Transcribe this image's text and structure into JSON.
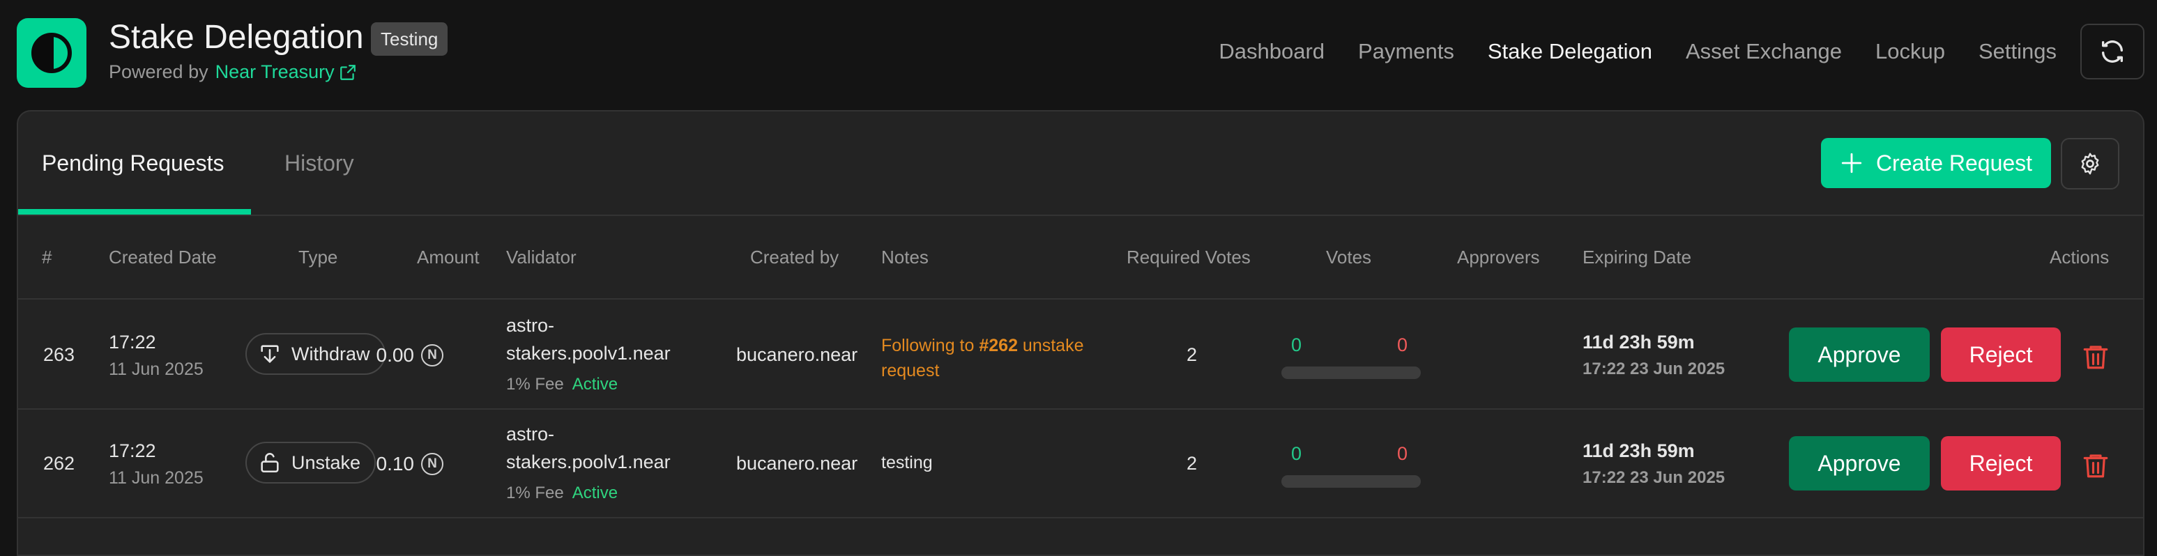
{
  "header": {
    "title": "Stake Delegation",
    "badge": "Testing",
    "powered_prefix": "Powered by",
    "powered_link": "Near Treasury",
    "nav": [
      "Dashboard",
      "Payments",
      "Stake Delegation",
      "Asset Exchange",
      "Lockup",
      "Settings"
    ],
    "active_nav": "Stake Delegation"
  },
  "tabs": [
    "Pending Requests",
    "History"
  ],
  "actions": {
    "create_label": "Create Request"
  },
  "table": {
    "columns": [
      "#",
      "Created Date",
      "Type",
      "Amount",
      "Validator",
      "Created by",
      "Notes",
      "Required Votes",
      "Votes",
      "Approvers",
      "Expiring Date",
      "Actions"
    ],
    "rows": [
      {
        "id": "263",
        "time": "17:22",
        "date": "11 Jun 2025",
        "type": "Withdraw",
        "type_icon": "withdraw-icon",
        "amount": "0.00",
        "validator_line1": "astro-",
        "validator_line2": "stakers.poolv1.near",
        "fee": "1% Fee",
        "status": "Active",
        "created_by": "bucanero.near",
        "notes_prefix": "Following to ",
        "notes_ref": "#262",
        "notes_suffix": " unstake request",
        "required_votes": "2",
        "votes_approve": "0",
        "votes_reject": "0",
        "expiring_in": "11d 23h 59m",
        "expiring_at": "17:22 23 Jun 2025",
        "approve_label": "Approve",
        "reject_label": "Reject"
      },
      {
        "id": "262",
        "time": "17:22",
        "date": "11 Jun 2025",
        "type": "Unstake",
        "type_icon": "unlock-icon",
        "amount": "0.10",
        "validator_line1": "astro-",
        "validator_line2": "stakers.poolv1.near",
        "fee": "1% Fee",
        "status": "Active",
        "created_by": "bucanero.near",
        "notes": "testing",
        "required_votes": "2",
        "votes_approve": "0",
        "votes_reject": "0",
        "expiring_in": "11d 23h 59m",
        "expiring_at": "17:22 23 Jun 2025",
        "approve_label": "Approve",
        "reject_label": "Reject"
      }
    ]
  },
  "colors": {
    "accent": "#00d494",
    "approve": "#047a50",
    "reject": "#e03149",
    "note_highlight": "#e48a20"
  }
}
